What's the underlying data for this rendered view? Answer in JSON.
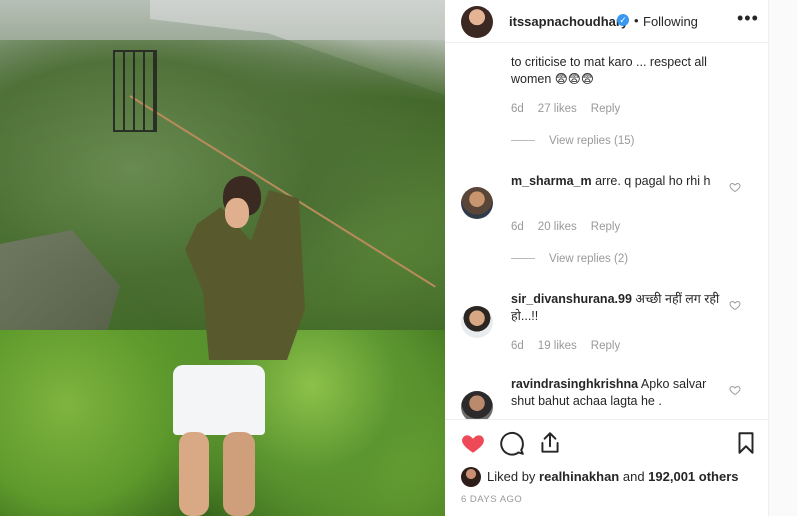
{
  "post": {
    "username": "itssapnachoudhary",
    "separator": "•",
    "follow_state": "Following",
    "more_label": "•••"
  },
  "comments": [
    {
      "text": "to criticise to mat karo ... respect all women 😨😨😨",
      "age": "6d",
      "likes": "27 likes",
      "reply": "Reply",
      "view_replies": "View replies (15)"
    },
    {
      "username": "m_sharma_m",
      "text": "arre. q pagal ho rhi h",
      "age": "6d",
      "likes": "20 likes",
      "reply": "Reply",
      "view_replies": "View replies (2)"
    },
    {
      "username": "sir_divanshurana.99",
      "text": "अच्छी नहीं लग रही हो...!!",
      "age": "6d",
      "likes": "19 likes",
      "reply": "Reply"
    },
    {
      "username": "ravindrasinghkrishna",
      "text": "Apko salvar shut bahut achaa lagta he ."
    }
  ],
  "likes_line": {
    "prefix": "Liked by ",
    "user": "realhinakhan",
    "middle": " and ",
    "count": "192,001 others"
  },
  "time_ago": "6 DAYS AGO",
  "icons": {
    "like": "heart-icon",
    "comment": "comment-icon",
    "share": "share-icon",
    "save": "bookmark-icon",
    "verified": "verified-badge-icon"
  },
  "colors": {
    "like_red": "#ed4956",
    "verified_blue": "#3897f0",
    "secondary_text": "#999999"
  }
}
